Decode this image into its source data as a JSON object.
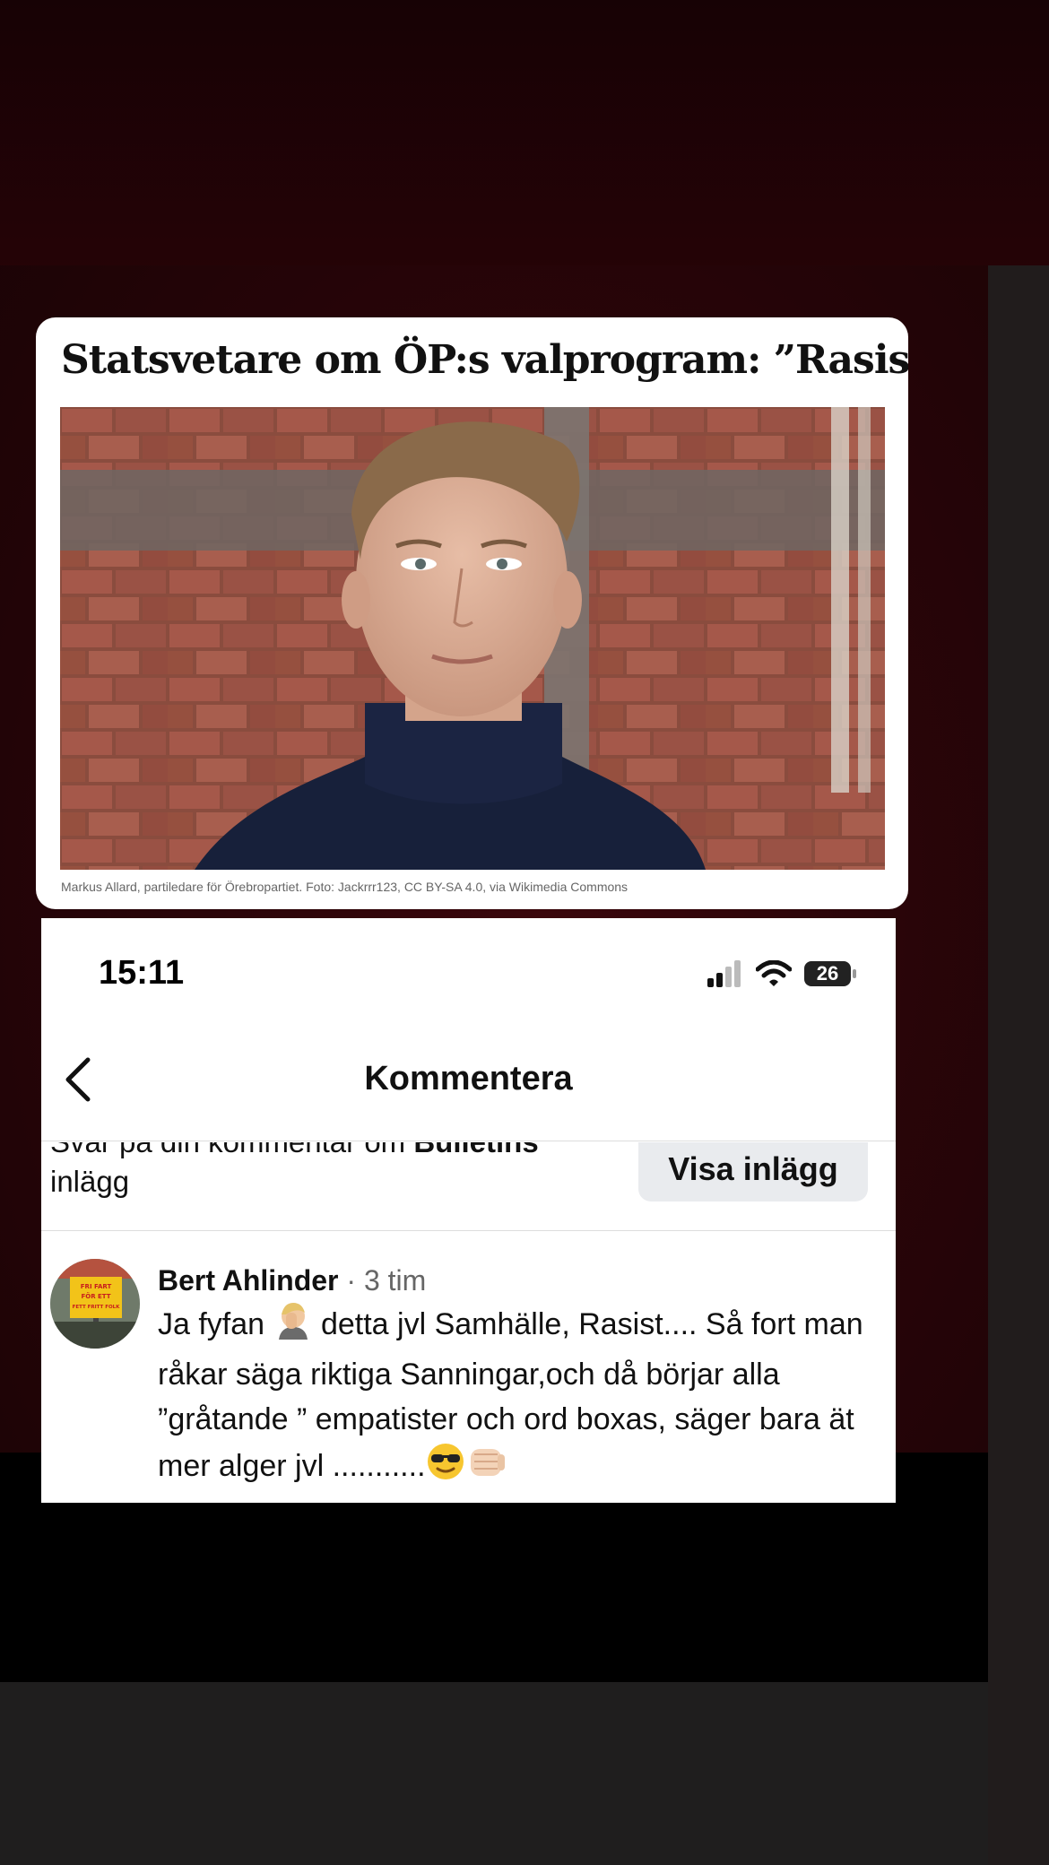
{
  "article": {
    "headline": "Statsvetare om ÖP:s valprogram: ”Rasism”",
    "caption": "Markus Allard, partiledare för Örebropartiet. Foto: Jackrrr123, CC BY-SA 4.0, via Wikimedia Commons"
  },
  "phone": {
    "status": {
      "time": "15:11",
      "battery": "26"
    },
    "nav": {
      "title": "Kommentera"
    },
    "context": {
      "prefix": "Svar på din kommentar om ",
      "page": "Bulletins",
      "suffix": " inlägg"
    },
    "view_post_button": "Visa inlägg",
    "comment": {
      "author": "Bert Ahlinder",
      "time_sep": " · ",
      "time": "3 tim",
      "text_1": "Ja fyfan ",
      "text_2": " detta jvl Samhälle, Rasist.... Så fort man råkar säga riktiga Sanningar,och då börjar alla ”gråtande ” empatister och ord boxas, säger bara ät mer alger jvl ...........",
      "avatar_sign": [
        "FRI FART",
        "FÖR ETT",
        "FETT FRITT FOLK"
      ]
    }
  }
}
